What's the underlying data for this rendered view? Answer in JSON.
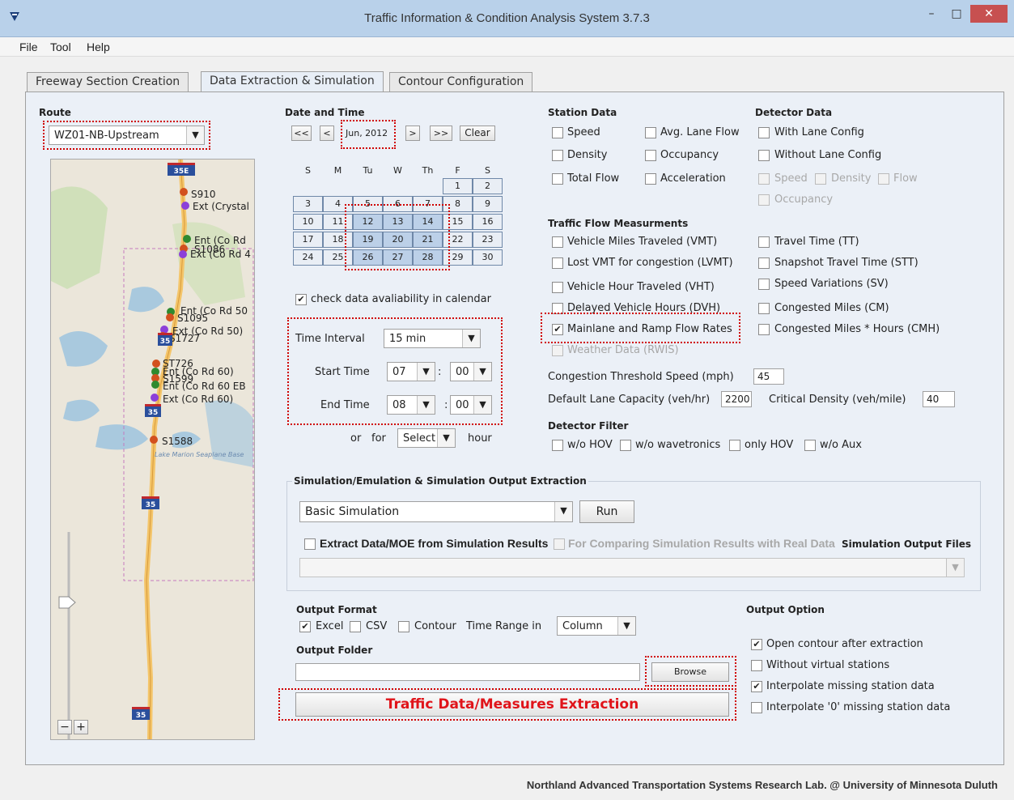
{
  "window": {
    "title": "Traffic Information & Condition Analysis System  3.7.3",
    "minimize": "–",
    "maximize": "□",
    "close": "✕"
  },
  "menu": [
    "File",
    "Tool",
    "Help"
  ],
  "tabs": [
    "Freeway Section Creation",
    "Data Extraction & Simulation",
    "Contour Configuration"
  ],
  "route": {
    "label": "Route",
    "value": "WZ01-NB-Upstream"
  },
  "map": {
    "labels": [
      "S910",
      "Ext (Crystal",
      "Ent (Co Rd",
      "S1086",
      "Ext (Co Rd 4",
      "Ent (Co Rd 50",
      "S1095",
      "Ext (Co Rd 50)",
      "S1727",
      "ST726",
      "Ent (Co Rd 60)",
      "S1599",
      "Ent (Co Rd 60 EB",
      "Ext (Co Rd 60)",
      "S1588",
      "Lake Marion Seaplane Base"
    ],
    "shields": [
      "35E",
      "35",
      "35",
      "35",
      "35"
    ],
    "zoom_out": "−",
    "zoom_in": "+"
  },
  "date": {
    "label": "Date and Time",
    "nav": [
      "<<",
      "<",
      ">",
      ">>"
    ],
    "month": "Jun, 2012",
    "clear": "Clear",
    "weekdays": [
      "S",
      "M",
      "Tu",
      "W",
      "Th",
      "F",
      "S"
    ],
    "rows": [
      [
        "",
        "",
        "",
        "",
        "",
        "1",
        "2"
      ],
      [
        "3",
        "4",
        "5",
        "6",
        "7",
        "8",
        "9"
      ],
      [
        "10",
        "11",
        "12",
        "13",
        "14",
        "15",
        "16"
      ],
      [
        "17",
        "18",
        "19",
        "20",
        "21",
        "22",
        "23"
      ],
      [
        "24",
        "25",
        "26",
        "27",
        "28",
        "29",
        "30"
      ]
    ],
    "selected": [
      "12",
      "13",
      "14",
      "19",
      "20",
      "21",
      "26",
      "27",
      "28"
    ],
    "availability": "check data avaliability in calendar",
    "time_interval_label": "Time Interval",
    "time_interval": "15 min",
    "start_label": "Start Time",
    "start_h": "07",
    "start_m": "00",
    "end_label": "End Time",
    "end_h": "08",
    "end_m": "00",
    "or_label": "or",
    "for_label": "for",
    "select": "Select",
    "hour": "hour",
    "colon": ":"
  },
  "station": {
    "label": "Station Data",
    "items": [
      "Speed",
      "Avg. Lane Flow",
      "Density",
      "Occupancy",
      "Total Flow",
      "Acceleration"
    ]
  },
  "detector": {
    "label": "Detector Data",
    "with_lane": "With Lane Config",
    "without_lane": "Without Lane Config",
    "sub": [
      "Speed",
      "Density",
      "Flow",
      "Occupancy"
    ]
  },
  "flow": {
    "label": "Traffic Flow Measurments",
    "left": [
      "Vehicle Miles Traveled (VMT)",
      "Lost VMT for congestion (LVMT)",
      "Vehicle Hour Traveled (VHT)",
      "Delayed Vehicle Hours (DVH)",
      "Mainlane and Ramp Flow Rates",
      "Weather Data (RWIS)"
    ],
    "right": [
      "Travel Time (TT)",
      "Snapshot Travel Time (STT)",
      "Speed Variations (SV)",
      "Congested Miles (CM)",
      "Congested Miles * Hours (CMH)"
    ]
  },
  "params": {
    "threshold_label": "Congestion Threshold Speed (mph)",
    "threshold": "45",
    "capacity_label": "Default Lane Capacity (veh/hr)",
    "capacity": "2200",
    "density_label": "Critical Density (veh/mile)",
    "density": "40"
  },
  "filter": {
    "label": "Detector Filter",
    "items": [
      "w/o HOV",
      "w/o wavetronics",
      "only HOV",
      "w/o Aux"
    ]
  },
  "sim": {
    "label": "Simulation/Emulation & Simulation Output Extraction",
    "mode": "Basic Simulation",
    "run": "Run",
    "extract": "Extract Data/MOE from Simulation Results",
    "compare": "For Comparing Simulation Results with Real Data",
    "files": "Simulation Output Files"
  },
  "output": {
    "format_label": "Output Format",
    "excel": "Excel",
    "csv": "CSV",
    "contour": "Contour",
    "time_range_label": "Time Range  in",
    "time_range": "Column",
    "folder_label": "Output Folder",
    "browse": "Browse",
    "extract_button": "Traffic Data/Measures Extraction"
  },
  "options": {
    "label": "Output Option",
    "items": [
      "Open contour after extraction",
      "Without virtual stations",
      "Interpolate missing station data",
      "Interpolate '0' missing station data"
    ]
  },
  "footer": "Northland Advanced Transportation Systems Research Lab. @ University of Minnesota Duluth",
  "colors": {
    "accent_red": "#d00000",
    "titlebar": "#b9d1ea",
    "close": "#c75050"
  }
}
